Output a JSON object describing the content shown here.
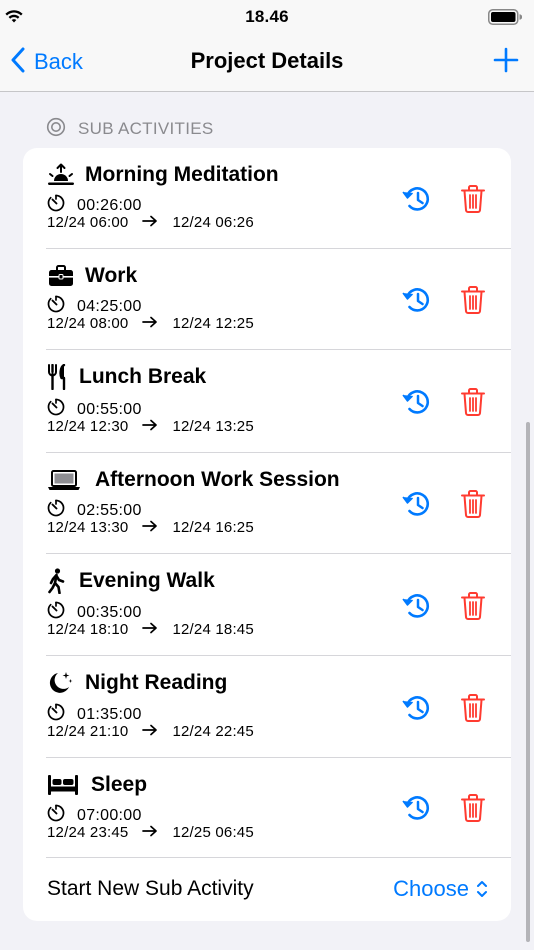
{
  "status_bar": {
    "time": "18.46"
  },
  "nav": {
    "back_label": "Back",
    "title": "Project Details"
  },
  "section": {
    "title": "SUB ACTIVITIES"
  },
  "activities": [
    {
      "name": "Morning Meditation",
      "icon": "sunrise-icon",
      "duration": "00:26:00",
      "start": "12/24 06:00",
      "end": "12/24 06:26"
    },
    {
      "name": "Work",
      "icon": "briefcase-icon",
      "duration": "04:25:00",
      "start": "12/24 08:00",
      "end": "12/24 12:25"
    },
    {
      "name": "Lunch Break",
      "icon": "fork-knife-icon",
      "duration": "00:55:00",
      "start": "12/24 12:30",
      "end": "12/24 13:25"
    },
    {
      "name": "Afternoon Work Session",
      "icon": "laptop-icon",
      "duration": "02:55:00",
      "start": "12/24 13:30",
      "end": "12/24 16:25"
    },
    {
      "name": "Evening Walk",
      "icon": "walking-person-icon",
      "duration": "00:35:00",
      "start": "12/24 18:10",
      "end": "12/24 18:45"
    },
    {
      "name": "Night Reading",
      "icon": "moon-stars-icon",
      "duration": "01:35:00",
      "start": "12/24 21:10",
      "end": "12/24 22:45"
    },
    {
      "name": "Sleep",
      "icon": "bed-icon",
      "duration": "07:00:00",
      "start": "12/24 23:45",
      "end": "12/25 06:45"
    }
  ],
  "new_sub_activity": {
    "label": "Start New Sub Activity",
    "select_value": "Choose"
  },
  "colors": {
    "accent": "#007aff",
    "destructive": "#ff3b30",
    "secondary": "#8a8a8e"
  }
}
